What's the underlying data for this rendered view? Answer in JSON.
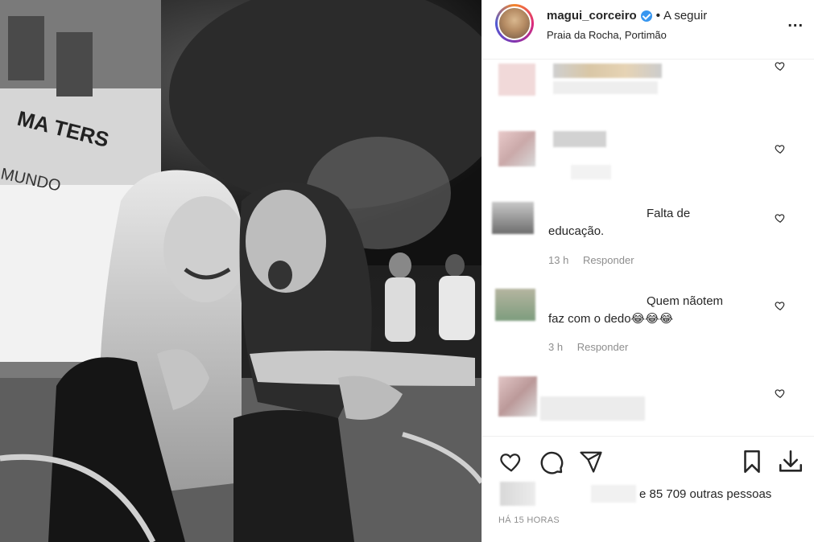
{
  "header": {
    "username": "magui_corceiro",
    "separator": "•",
    "follow_label": "A seguir",
    "location": "Praia da Rocha, Portimão",
    "more_label": "..."
  },
  "comments": [
    {
      "text": "Falta de\neducação.",
      "time": "13 h",
      "reply_label": "Responder"
    },
    {
      "text": "Quem nãotem\nfaz com o dedo😂😂😂",
      "time": "3 h",
      "reply_label": "Responder"
    }
  ],
  "likes": {
    "text": "e 85 709 outras pessoas"
  },
  "posted_ago": "HÁ 15 HORAS",
  "photo": {
    "sign_text_1": "MA  TERS",
    "sign_text_2": "MUNDO"
  },
  "icons": {
    "like": "heart-icon",
    "comment": "comment-icon",
    "share": "paper-plane-icon",
    "save": "bookmark-icon",
    "download": "download-icon",
    "verified": "verified-badge-icon"
  },
  "colors": {
    "verified": "#3897f0",
    "meta": "#8e8e8e",
    "border": "#efefef"
  }
}
